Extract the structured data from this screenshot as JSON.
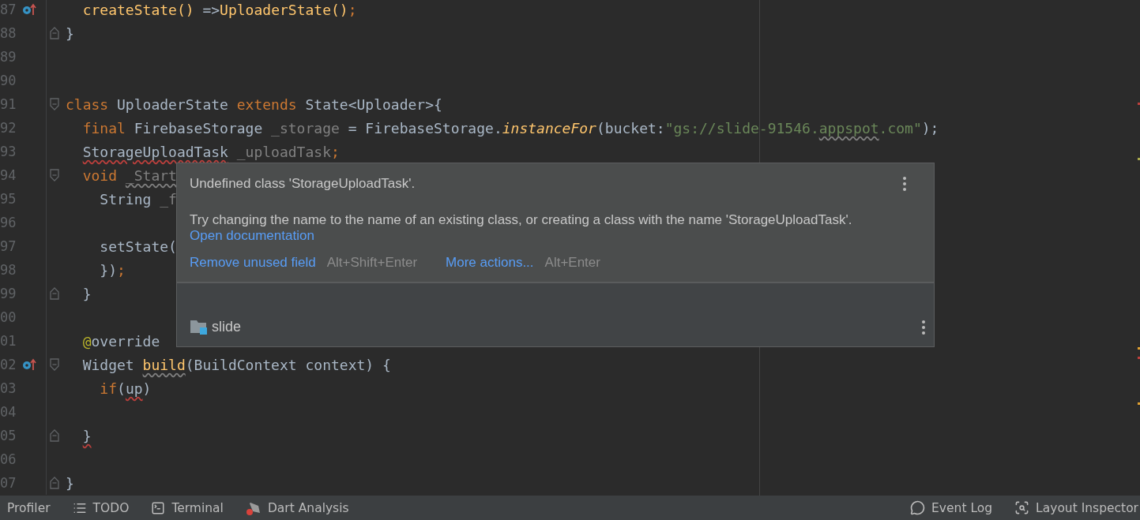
{
  "editor": {
    "lines": [
      {
        "number": "87",
        "override_marker": true,
        "tokens": [
          {
            "text": "  createState()",
            "kind": "call"
          },
          {
            "text": " =>",
            "kind": "plain"
          },
          {
            "text": "UploaderState()",
            "kind": "call"
          },
          {
            "text": ";",
            "kind": "keyword"
          }
        ]
      },
      {
        "number": "88",
        "fold_end": true,
        "tokens": [
          {
            "text": "}",
            "kind": "plain"
          }
        ]
      },
      {
        "number": "89"
      },
      {
        "number": "90"
      },
      {
        "number": "91",
        "fold_start": true,
        "tokens": [
          {
            "text": "class",
            "kind": "keyword"
          },
          {
            "text": " UploaderState ",
            "kind": "plain"
          },
          {
            "text": "extends",
            "kind": "keyword"
          },
          {
            "text": " State<Uploader>{",
            "kind": "plain"
          }
        ]
      },
      {
        "number": "92",
        "tokens": [
          {
            "text": "  final",
            "kind": "keyword"
          },
          {
            "text": " FirebaseStorage ",
            "kind": "plain"
          },
          {
            "text": "_storage",
            "kind": "unused"
          },
          {
            "text": " = FirebaseStorage.",
            "kind": "plain"
          },
          {
            "text": "instanceFor",
            "kind": "static"
          },
          {
            "text": "(bucket:",
            "kind": "plain"
          },
          {
            "text": "\"gs://slide-91546.",
            "kind": "string"
          },
          {
            "text": "appspot",
            "kind": "string",
            "warning": true
          },
          {
            "text": ".com\"",
            "kind": "string"
          },
          {
            "text": ");",
            "kind": "plain"
          }
        ]
      },
      {
        "number": "93",
        "tokens": [
          {
            "text": "  StorageUploadTask",
            "kind": "plain",
            "error": true
          },
          {
            "text": " _uploadTask",
            "kind": "unused"
          },
          {
            "text": ";",
            "kind": "keyword"
          }
        ]
      },
      {
        "number": "94",
        "fold_start": true,
        "tokens": [
          {
            "text": "  void ",
            "kind": "keyword"
          },
          {
            "text": "_Start",
            "kind": "unused",
            "warning": true
          }
        ]
      },
      {
        "number": "95",
        "tokens": [
          {
            "text": "    String ",
            "kind": "plain"
          },
          {
            "text": "_f",
            "kind": "unused"
          }
        ]
      },
      {
        "number": "96"
      },
      {
        "number": "97",
        "tokens": [
          {
            "text": "    setState(",
            "kind": "plain"
          }
        ]
      },
      {
        "number": "98",
        "tokens": [
          {
            "text": "    })",
            "kind": "plain"
          },
          {
            "text": ";",
            "kind": "keyword"
          }
        ]
      },
      {
        "number": "99",
        "fold_end": true,
        "tokens": [
          {
            "text": "  }",
            "kind": "plain"
          }
        ]
      },
      {
        "number": "00"
      },
      {
        "number": "01",
        "tokens": [
          {
            "text": "  @",
            "kind": "annotation"
          },
          {
            "text": "override",
            "kind": "plain"
          }
        ]
      },
      {
        "number": "02",
        "override_marker": true,
        "fold_start": true,
        "tokens": [
          {
            "text": "  Widget ",
            "kind": "plain"
          },
          {
            "text": "build",
            "kind": "call",
            "warning": true
          },
          {
            "text": "(BuildContext context) {",
            "kind": "plain"
          }
        ]
      },
      {
        "number": "03",
        "tokens": [
          {
            "text": "    if",
            "kind": "keyword"
          },
          {
            "text": "(",
            "kind": "plain"
          },
          {
            "text": "up",
            "kind": "plain",
            "error": true
          },
          {
            "text": ")",
            "kind": "plain"
          }
        ]
      },
      {
        "number": "04"
      },
      {
        "number": "05",
        "fold_end": true,
        "tokens": [
          {
            "text": "  }",
            "kind": "plain",
            "error": true
          }
        ]
      },
      {
        "number": "06"
      },
      {
        "number": "07",
        "fold_end": true,
        "tokens": [
          {
            "text": "}",
            "kind": "plain"
          }
        ]
      }
    ]
  },
  "popup": {
    "title": "Undefined class 'StorageUploadTask'.",
    "description": "Try changing the name to the name of an existing class, or creating a class with the name 'StorageUploadTask'.",
    "doc_link": "Open documentation",
    "actions": [
      {
        "label": "Remove unused field",
        "shortcut": "Alt+Shift+Enter"
      },
      {
        "label": "More actions...",
        "shortcut": "Alt+Enter"
      }
    ],
    "module": "slide"
  },
  "tool_bar": {
    "left": [
      {
        "label": "Profiler"
      },
      {
        "label": "TODO"
      },
      {
        "label": "Terminal"
      },
      {
        "label": "Dart Analysis"
      }
    ],
    "right": [
      {
        "label": "Event Log"
      },
      {
        "label": "Layout Inspector"
      }
    ]
  }
}
